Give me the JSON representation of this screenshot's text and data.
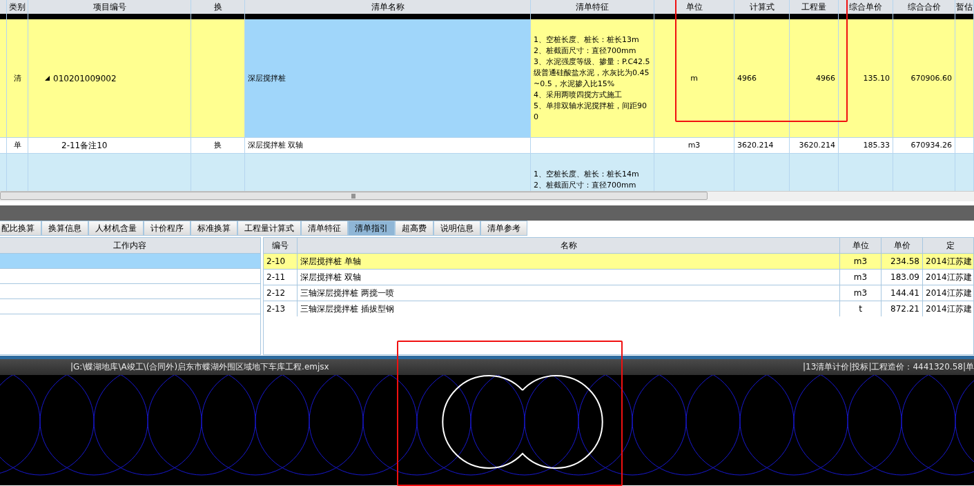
{
  "table": {
    "columns": [
      "类别",
      "项目编号",
      "换",
      "清单名称",
      "清单特征",
      "单位",
      "计算式",
      "工程量",
      "综合单价",
      "综合合价",
      "暂估"
    ],
    "rows": [
      {
        "kind": "bill",
        "selected": true,
        "expanded": true,
        "type": "清",
        "code": "010201009002",
        "name": "深层搅拌桩",
        "features": "1、空桩长度、桩长：桩长13m\n2、桩截面尺寸：直径700mm\n3、水泥强度等级、掺量：P.C42.5级普通硅酸盐水泥，水灰比为0.45~0.5，水泥掺入比15%\n4、采用两喷四搅方式施工\n5、单排双轴水泥搅拌桩，间距900",
        "unit": "m",
        "formula": "4966",
        "quantity": "4966",
        "unit_price": "135.10",
        "total": "670906.60"
      },
      {
        "kind": "item",
        "selected": false,
        "type": "单",
        "code": "2-11备注10",
        "swap": "换",
        "name": "深层搅拌桩 双轴",
        "unit": "m3",
        "formula": "3620.214",
        "quantity": "3620.214",
        "unit_price": "185.33",
        "total": "670934.26"
      },
      {
        "kind": "bill",
        "selected": false,
        "features": "1、空桩长度、桩长：桩长14m\n2、桩截面尺寸：直径700mm"
      }
    ]
  },
  "tabs": [
    {
      "label": "配比换算",
      "selected": false
    },
    {
      "label": "换算信息",
      "selected": false
    },
    {
      "label": "人材机含量",
      "selected": false
    },
    {
      "label": "计价程序",
      "selected": false
    },
    {
      "label": "标准换算",
      "selected": false
    },
    {
      "label": "工程量计算式",
      "selected": false
    },
    {
      "label": "清单特征",
      "selected": false
    },
    {
      "label": "清单指引",
      "selected": true
    },
    {
      "label": "超高费",
      "selected": false
    },
    {
      "label": "说明信息",
      "selected": false
    },
    {
      "label": "清单参考",
      "selected": false
    }
  ],
  "work_content": {
    "title": "工作内容",
    "rows": [
      {
        "selected": true
      },
      {
        "selected": false
      },
      {
        "selected": false
      },
      {
        "selected": false
      }
    ]
  },
  "guide": {
    "columns": [
      "编号",
      "名称",
      "单位",
      "单价",
      "定"
    ],
    "rows": [
      {
        "code": "2-10",
        "name": "深层搅拌桩 单轴",
        "unit": "m3",
        "price": "234.58",
        "quota": "2014江苏建",
        "selected": true
      },
      {
        "code": "2-11",
        "name": "深层搅拌桩 双轴",
        "unit": "m3",
        "price": "183.09",
        "quota": "2014江苏建",
        "selected": false
      },
      {
        "code": "2-12",
        "name": "三轴深层搅拌桩 两搅一喷",
        "unit": "m3",
        "price": "144.41",
        "quota": "2014江苏建",
        "selected": false
      },
      {
        "code": "2-13",
        "name": "三轴深层搅拌桩 插拔型钢",
        "unit": "t",
        "price": "872.21",
        "quota": "2014江苏建",
        "selected": false
      }
    ]
  },
  "status_bar": {
    "path": "|G:\\蝶湖地库\\A竣工\\(合同外)启东市蝶湖外围区域地下车库工程.emjsx",
    "items": [
      "|13清单计价",
      "|投标",
      "|工程造价：4441320.58",
      "|单"
    ]
  }
}
